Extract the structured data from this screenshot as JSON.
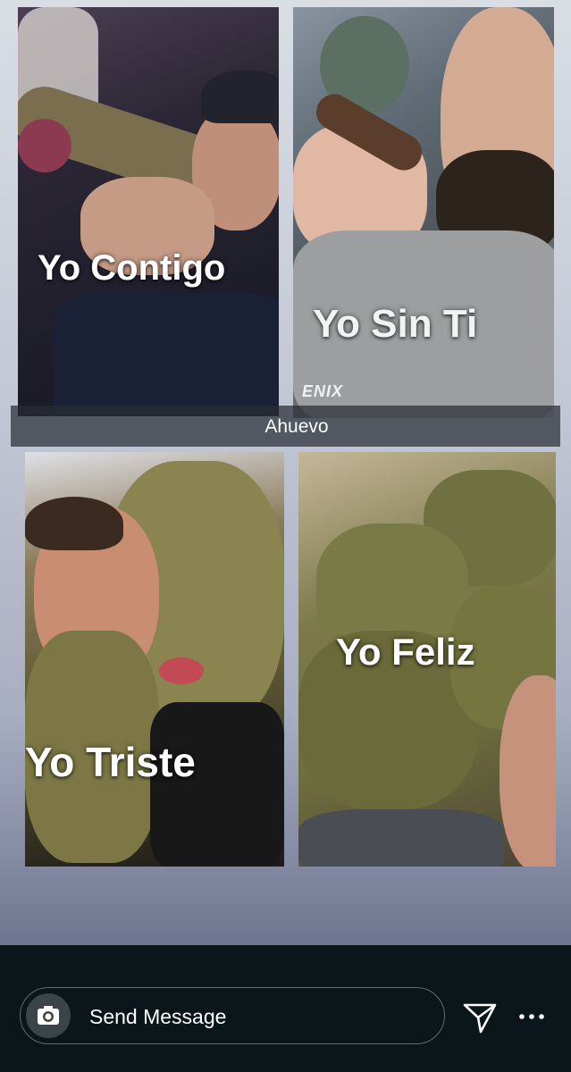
{
  "story": {
    "panels": [
      {
        "caption": "Yo Contigo"
      },
      {
        "caption": "Yo Sin Ti",
        "watermark": "ENIX"
      },
      {
        "caption": "Yo Triste"
      },
      {
        "caption": "Yo Feliz"
      }
    ],
    "tag_text": "Ahuevo"
  },
  "composer": {
    "placeholder": "Send Message",
    "camera_icon": "camera-icon",
    "send_icon": "send-icon",
    "more_icon": "more-icon"
  }
}
